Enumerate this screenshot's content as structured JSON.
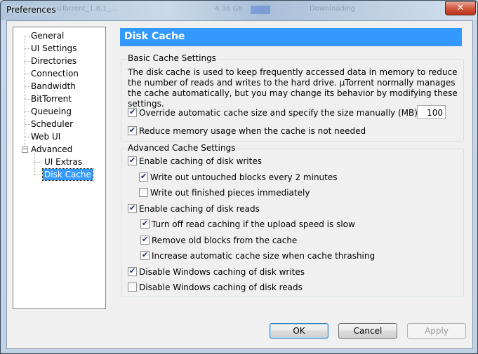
{
  "window": {
    "title": "Preferences",
    "close_glyph": "✕"
  },
  "background_titles": [
    "uTorrent_1.8.1_...",
    "4.36 Gb",
    "Downloading"
  ],
  "tree": {
    "items": [
      {
        "label": "General"
      },
      {
        "label": "UI Settings"
      },
      {
        "label": "Directories"
      },
      {
        "label": "Connection"
      },
      {
        "label": "Bandwidth"
      },
      {
        "label": "BitTorrent"
      },
      {
        "label": "Queueing"
      },
      {
        "label": "Scheduler"
      },
      {
        "label": "Web UI"
      },
      {
        "label": "Advanced",
        "expanded": true
      },
      {
        "label": "UI Extras"
      },
      {
        "label": "Disk Cache",
        "selected": true
      }
    ],
    "expander_symbol": "−"
  },
  "page": {
    "title": "Disk Cache"
  },
  "basic": {
    "legend": "Basic Cache Settings",
    "description": "The disk cache is used to keep frequently accessed data in memory to reduce the number of reads and writes to the hard drive. µTorrent normally manages the cache automatically, but you may change its behavior by modifying these settings.",
    "override_label": "Override automatic cache size and specify the size manually (MB):",
    "override_checked": true,
    "cache_size": "100",
    "reduce_label": "Reduce memory usage when the cache is not needed",
    "reduce_checked": true
  },
  "advanced": {
    "legend": "Advanced Cache Settings",
    "options": [
      {
        "label": "Enable caching of disk writes",
        "checked": true
      },
      {
        "label": "Write out untouched blocks every 2 minutes",
        "checked": true
      },
      {
        "label": "Write out finished pieces immediately",
        "checked": false
      },
      {
        "label": "Enable caching of disk reads",
        "checked": true
      },
      {
        "label": "Turn off read caching if the upload speed is slow",
        "checked": true
      },
      {
        "label": "Remove old blocks from the cache",
        "checked": true
      },
      {
        "label": "Increase automatic cache size when cache thrashing",
        "checked": true
      },
      {
        "label": "Disable Windows caching of disk writes",
        "checked": true
      },
      {
        "label": "Disable Windows caching of disk reads",
        "checked": false
      }
    ]
  },
  "buttons": {
    "ok": "OK",
    "cancel": "Cancel",
    "apply": "Apply"
  },
  "colors": {
    "selection": "#3399ff",
    "header_bg": "#3399ff"
  }
}
